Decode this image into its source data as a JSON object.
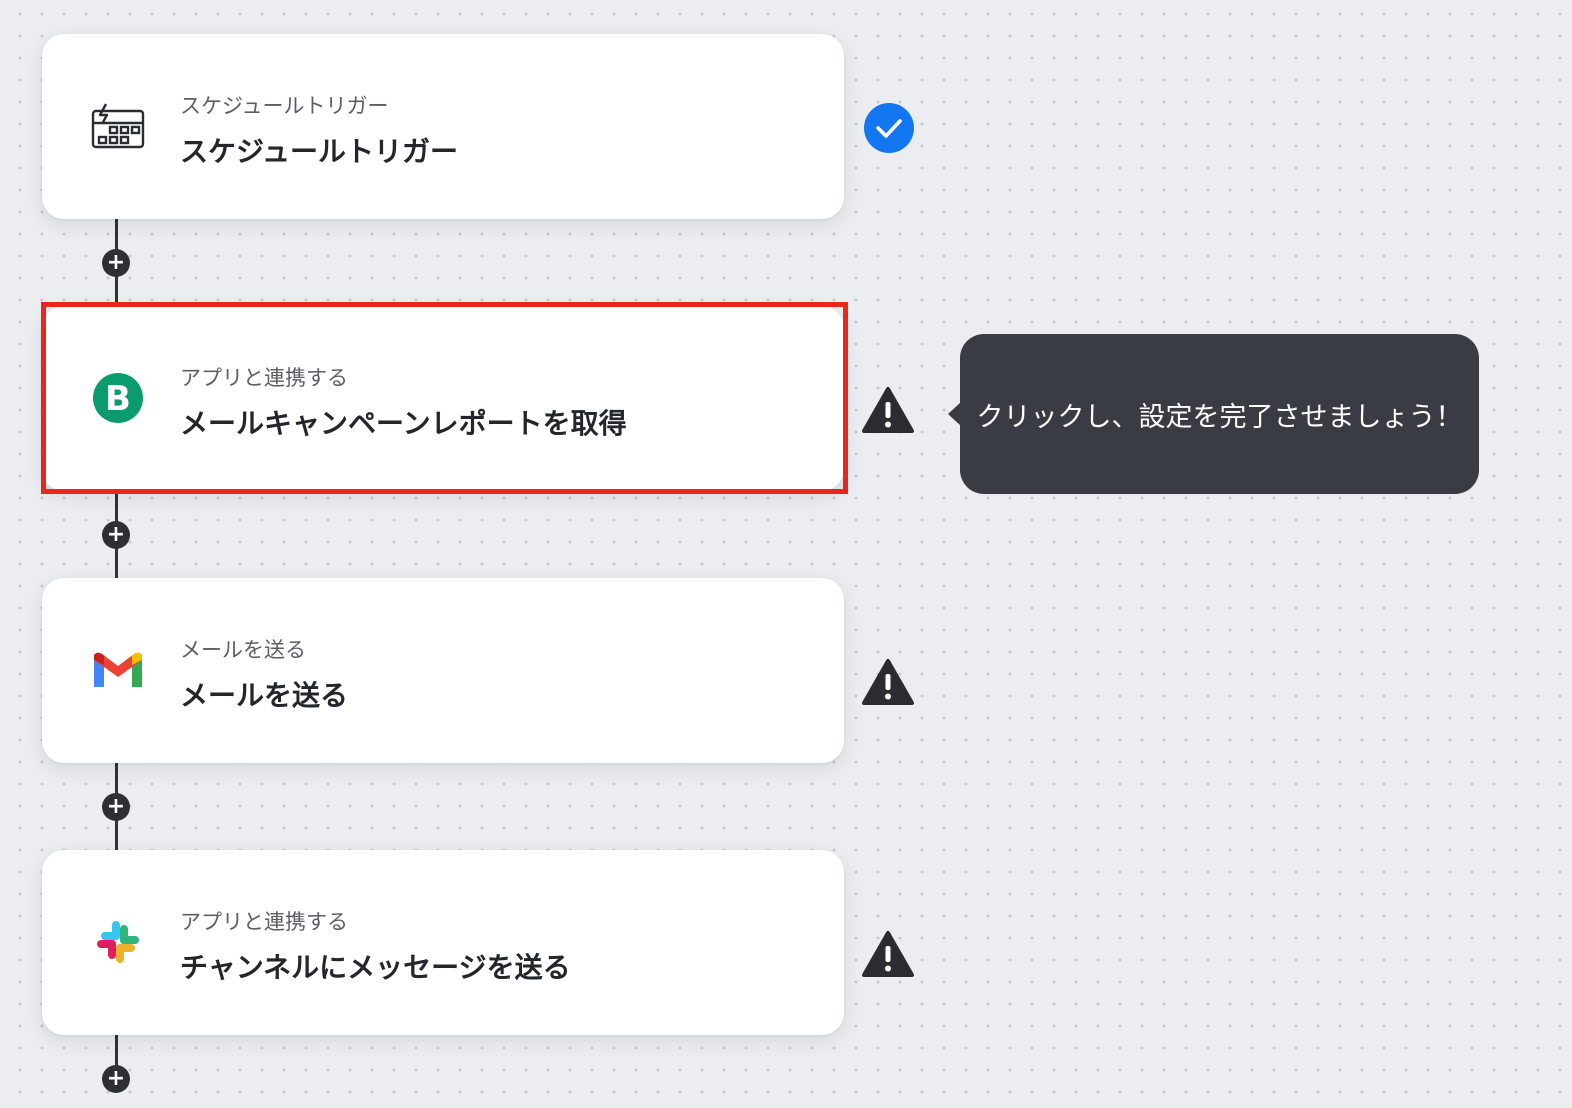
{
  "steps": [
    {
      "subtitle": "スケジュールトリガー",
      "title": "スケジュールトリガー",
      "icon": "schedule-calendar-icon",
      "status": "complete"
    },
    {
      "subtitle": "アプリと連携する",
      "title": "メールキャンペーンレポートを取得",
      "icon": "brevo-logo-icon",
      "status": "warning",
      "highlighted": true
    },
    {
      "subtitle": "メールを送る",
      "title": "メールを送る",
      "icon": "gmail-logo-icon",
      "status": "warning"
    },
    {
      "subtitle": "アプリと連携する",
      "title": "チャンネルにメッセージを送る",
      "icon": "slack-logo-icon",
      "status": "warning"
    }
  ],
  "tooltip": {
    "text": "クリックし、設定を完了させましょう！"
  },
  "colors": {
    "highlight_border": "#e8261c",
    "check_badge": "#1477f2",
    "tooltip_bg": "#393c43",
    "connector": "#2f3237"
  },
  "icons": {
    "add": "plus-icon",
    "complete": "check-circle-icon",
    "warning": "warning-triangle-icon"
  }
}
